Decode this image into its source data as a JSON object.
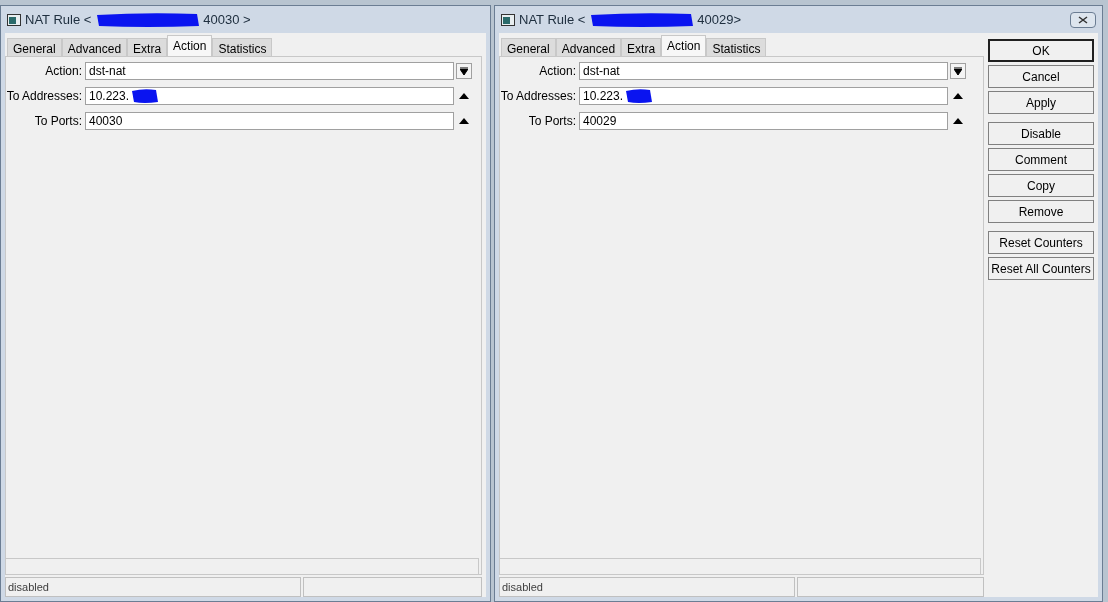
{
  "windows": [
    {
      "title_prefix": "NAT Rule <",
      "title_suffix": "40030 >",
      "title_redacted": true,
      "close_button": false,
      "tabs": [
        {
          "label": "General",
          "selected": false
        },
        {
          "label": "Advanced",
          "selected": false
        },
        {
          "label": "Extra",
          "selected": false
        },
        {
          "label": "Action",
          "selected": true
        },
        {
          "label": "Statistics",
          "selected": false
        }
      ],
      "fields": [
        {
          "label": "Action:",
          "value": "dst-nat",
          "kind": "dropdown",
          "redacted": false
        },
        {
          "label": "To Addresses:",
          "value": "10.223.",
          "kind": "spin",
          "redacted": true
        },
        {
          "label": "To Ports:",
          "value": "40030",
          "kind": "spin",
          "redacted": false
        }
      ],
      "status": "disabled"
    },
    {
      "title_prefix": "NAT Rule <",
      "title_suffix": "40029>",
      "title_redacted": true,
      "close_button": true,
      "tabs": [
        {
          "label": "General",
          "selected": false
        },
        {
          "label": "Advanced",
          "selected": false
        },
        {
          "label": "Extra",
          "selected": false
        },
        {
          "label": "Action",
          "selected": true
        },
        {
          "label": "Statistics",
          "selected": false
        }
      ],
      "fields": [
        {
          "label": "Action:",
          "value": "dst-nat",
          "kind": "dropdown",
          "redacted": false
        },
        {
          "label": "To Addresses:",
          "value": "10.223.",
          "kind": "spin",
          "redacted": true
        },
        {
          "label": "To Ports:",
          "value": "40029",
          "kind": "spin",
          "redacted": false
        }
      ],
      "status": "disabled",
      "button_groups": [
        [
          {
            "label": "OK",
            "default": true
          },
          {
            "label": "Cancel",
            "default": false
          },
          {
            "label": "Apply",
            "default": false
          }
        ],
        [
          {
            "label": "Disable",
            "default": false
          },
          {
            "label": "Comment",
            "default": false
          },
          {
            "label": "Copy",
            "default": false
          },
          {
            "label": "Remove",
            "default": false
          }
        ],
        [
          {
            "label": "Reset Counters",
            "default": false
          },
          {
            "label": "Reset All Counters",
            "default": false
          }
        ]
      ]
    }
  ]
}
